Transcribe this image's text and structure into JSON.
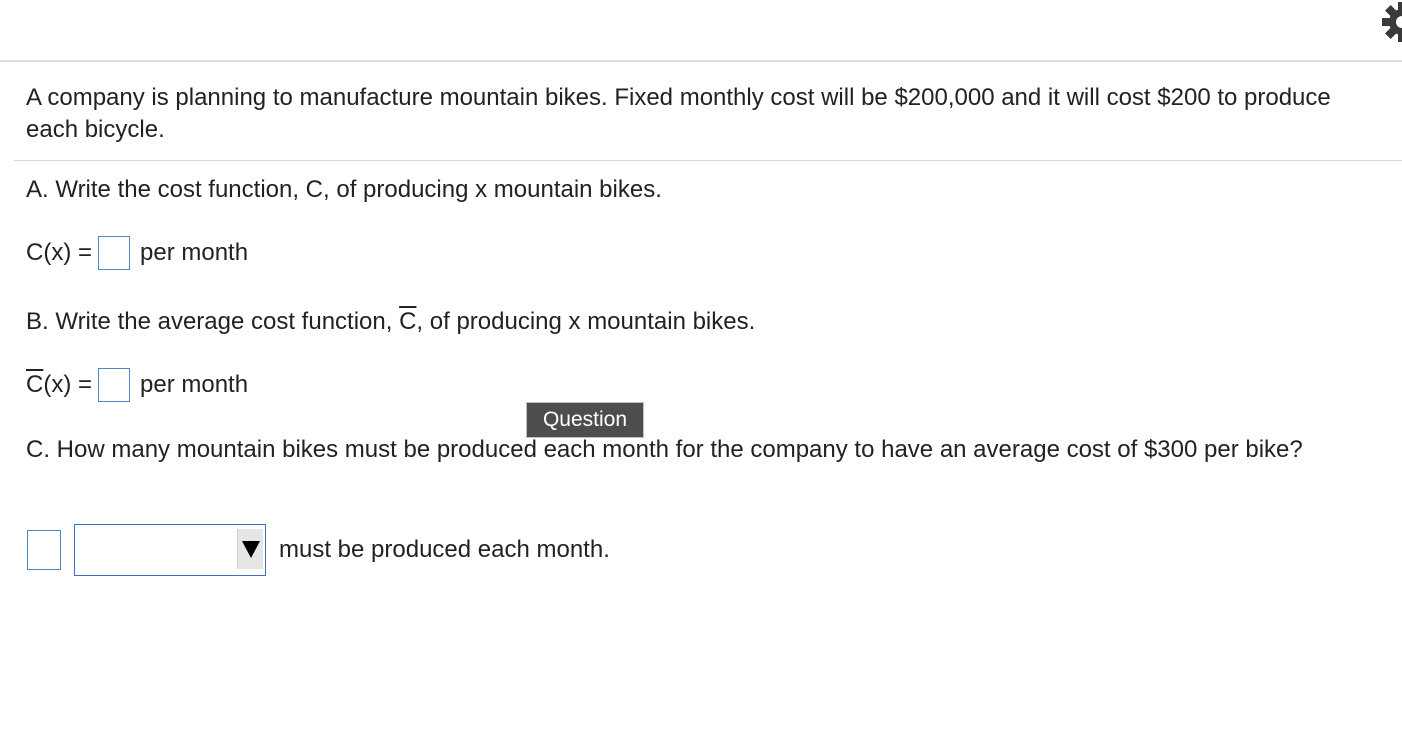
{
  "problem": {
    "intro": "A company is planning to manufacture mountain bikes. Fixed monthly cost will be $200,000 and it will cost $200 to produce each bicycle.",
    "part_a": {
      "prompt": "A. Write the cost function, C, of producing x mountain bikes.",
      "lhs": "C(x) =",
      "answer": "",
      "unit": "per month"
    },
    "part_b": {
      "prompt_before": "B. Write the average cost function, ",
      "prompt_symbol": "C",
      "prompt_after": ", of producing x mountain bikes.",
      "lhs_symbol": "C",
      "lhs_rest": "(x) =",
      "answer": "",
      "unit": "per month"
    },
    "part_c": {
      "prompt": "C. How many mountain bikes must be produced each month for the company to have an average cost of $300 per bike?",
      "answer": "",
      "unit_selected": "",
      "tail": "must be produced each month."
    }
  },
  "tooltip": {
    "label": "Question"
  },
  "icons": {
    "settings": "gear-icon",
    "dropdown": "triangle-down-icon"
  },
  "colors": {
    "input_border": "#4a86c8",
    "tooltip_bg": "#4d4d4d"
  }
}
